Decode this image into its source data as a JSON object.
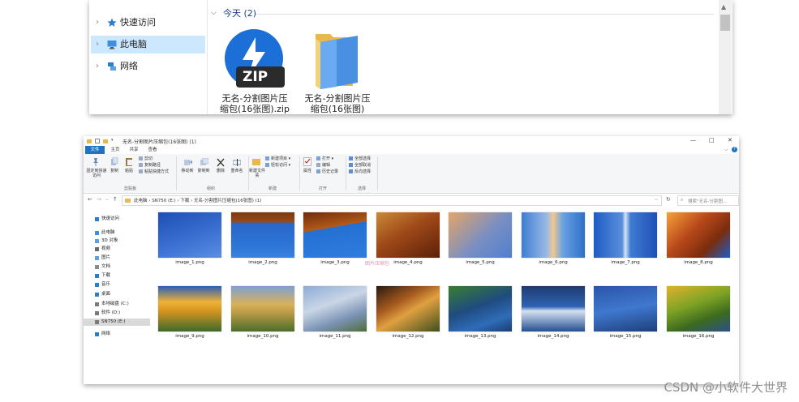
{
  "top_window": {
    "nav": [
      {
        "label": "快速访问",
        "icon": "star-icon",
        "selected": false
      },
      {
        "label": "此电脑",
        "icon": "computer-icon",
        "selected": true
      },
      {
        "label": "网络",
        "icon": "network-icon",
        "selected": false
      }
    ],
    "group_header": "今天 (2)",
    "items": [
      {
        "line1": "无名-分割图片压",
        "line2": "缩包(16张图).zip",
        "icon": "zip-icon"
      },
      {
        "line1": "无名-分割图片压",
        "line2": "缩包(16张图)",
        "icon": "folder-icon"
      }
    ],
    "zip_badge": "ZIP"
  },
  "bottom_window": {
    "title": "无名-分割图片压缩包(16张图) (1)",
    "window_controls": [
      "—",
      "□",
      "✕"
    ],
    "tabs": [
      "文件",
      "主页",
      "共享",
      "查看"
    ],
    "ribbon": {
      "clipboard": {
        "pin": "固定到快速访问",
        "copy": "复制",
        "paste": "粘贴",
        "cut": "剪切",
        "copy_path": "复制路径",
        "paste_shortcut": "粘贴快捷方式",
        "label": "剪贴板"
      },
      "organize": {
        "move_to": "移动到",
        "copy_to": "复制到",
        "delete": "删除",
        "rename": "重命名",
        "label": "组织"
      },
      "new": {
        "new_folder": "新建文件夹",
        "new_item": "新建项目 ▾",
        "easy_access": "轻松访问 ▾",
        "label": "新建"
      },
      "open": {
        "properties": "属性",
        "open": "打开 ▾",
        "edit": "编辑",
        "history": "历史记录",
        "label": "打开"
      },
      "select": {
        "select_all": "全部选择",
        "select_none": "全部取消",
        "invert": "反向选择",
        "label": "选择"
      }
    },
    "address": "此电脑  ›  SN750 (E:)  ›  下载  ›  无名-分割图片压缩包(16张图) (1)",
    "search_placeholder": "搜索\"无名-分割图...",
    "sidebar": [
      {
        "label": "快速访问",
        "icon": "star-icon",
        "color": "#2b7cd3"
      },
      {
        "label": "此电脑",
        "icon": "computer-icon",
        "color": "#3d8ee0"
      },
      {
        "label": "3D 对象",
        "icon": "cube-icon",
        "color": "#5aa0e6"
      },
      {
        "label": "视频",
        "icon": "video-icon",
        "color": "#6b6b6b"
      },
      {
        "label": "图片",
        "icon": "picture-icon",
        "color": "#5aa0e6"
      },
      {
        "label": "文档",
        "icon": "document-icon",
        "color": "#8c8c8c"
      },
      {
        "label": "下载",
        "icon": "download-icon",
        "color": "#2b7cd3"
      },
      {
        "label": "音乐",
        "icon": "music-icon",
        "color": "#2b7cd3"
      },
      {
        "label": "桌面",
        "icon": "desktop-icon",
        "color": "#2b7cd3"
      },
      {
        "label": "本地磁盘 (C:)",
        "icon": "drive-icon",
        "color": "#7a7a7a"
      },
      {
        "label": "软件 (D:)",
        "icon": "drive-icon",
        "color": "#7a7a7a"
      },
      {
        "label": "SN750 (E:)",
        "icon": "drive-icon",
        "color": "#7a7a7a",
        "selected": true
      },
      {
        "label": "网络",
        "icon": "network-icon",
        "color": "#2b7cd3"
      }
    ],
    "files": [
      {
        "name": "image_1.png",
        "bg": "linear-gradient(160deg,#1d4fb4 0%,#3b6fd1 55%,#5b8ee3 100%)"
      },
      {
        "name": "image_2.png",
        "bg": "linear-gradient(180deg,#7a3a12 0%,#9b4a18 22%,#2b66c9 23%,#2c74d6 70%,#3781de 100%)"
      },
      {
        "name": "image_3.png",
        "bg": "linear-gradient(170deg,#6e2c0c 0%,#b55a19 35%,#2470d2 36%,#2f7ce0 100%)"
      },
      {
        "name": "image_4.png",
        "bg": "linear-gradient(150deg,#c98a38 0%,#9e4818 45%,#5a2008 100%)"
      },
      {
        "name": "image_5.png",
        "bg": "linear-gradient(135deg,#e5a567 0%,#7a8fc2 55%,#4f7fd0 100%)"
      },
      {
        "name": "image_6.png",
        "bg": "linear-gradient(90deg,#3d7ed3 0%,#9ab9e6 40%,#f0c890 50%,#6aa1e2 65%,#2f6fc9 100%)"
      },
      {
        "name": "image_7.png",
        "bg": "linear-gradient(90deg,#1f5bc2 0%,#5a8fdc 45%,#d8e4f4 50%,#3f7cd3 58%,#1e4fb5 100%)"
      },
      {
        "name": "image_8.png",
        "bg": "linear-gradient(135deg,#f6a23a 0%,#b8481a 40%,#7a2d0e 70%,#1b5ec8 100%)"
      },
      {
        "name": "image_9.png",
        "bg": "linear-gradient(180deg,#2a5fb3 0%,#f0b236 35%,#d49420 55%,#3d6a2a 100%)"
      },
      {
        "name": "image_10.png",
        "bg": "linear-gradient(180deg,#7ea0d4 0%,#d9b15a 40%,#b79a45 60%,#4b6e2c 100%)"
      },
      {
        "name": "image_11.png",
        "bg": "linear-gradient(160deg,#8dabd6 0%,#cad6e6 40%,#7b93b5 70%,#4f6d3a 100%)"
      },
      {
        "name": "image_12.png",
        "bg": "linear-gradient(150deg,#2a1a0f 0%,#a65a1e 35%,#e0a040 55%,#3f4e1f 100%)"
      },
      {
        "name": "image_13.png",
        "bg": "linear-gradient(160deg,#3a7e2f 0%,#1f4b80 45%,#2f6cb8 75%,#1a3d70 100%)"
      },
      {
        "name": "image_14.png",
        "bg": "linear-gradient(180deg,#1f3b6f 0%,#2e62b3 45%,#d6e2f2 55%,#244f91 100%)"
      },
      {
        "name": "image_15.png",
        "bg": "linear-gradient(170deg,#2a55a8 0%,#3f78cf 50%,#1e3f7a 100%)"
      },
      {
        "name": "image_16.png",
        "bg": "linear-gradient(160deg,#e0b22e 0%,#7ea325 40%,#3c6a1f 70%,#2c4f8a 100%)"
      }
    ],
    "watermark_overlay": "图片压缩包"
  },
  "watermark": "CSDN @小软件大世界"
}
